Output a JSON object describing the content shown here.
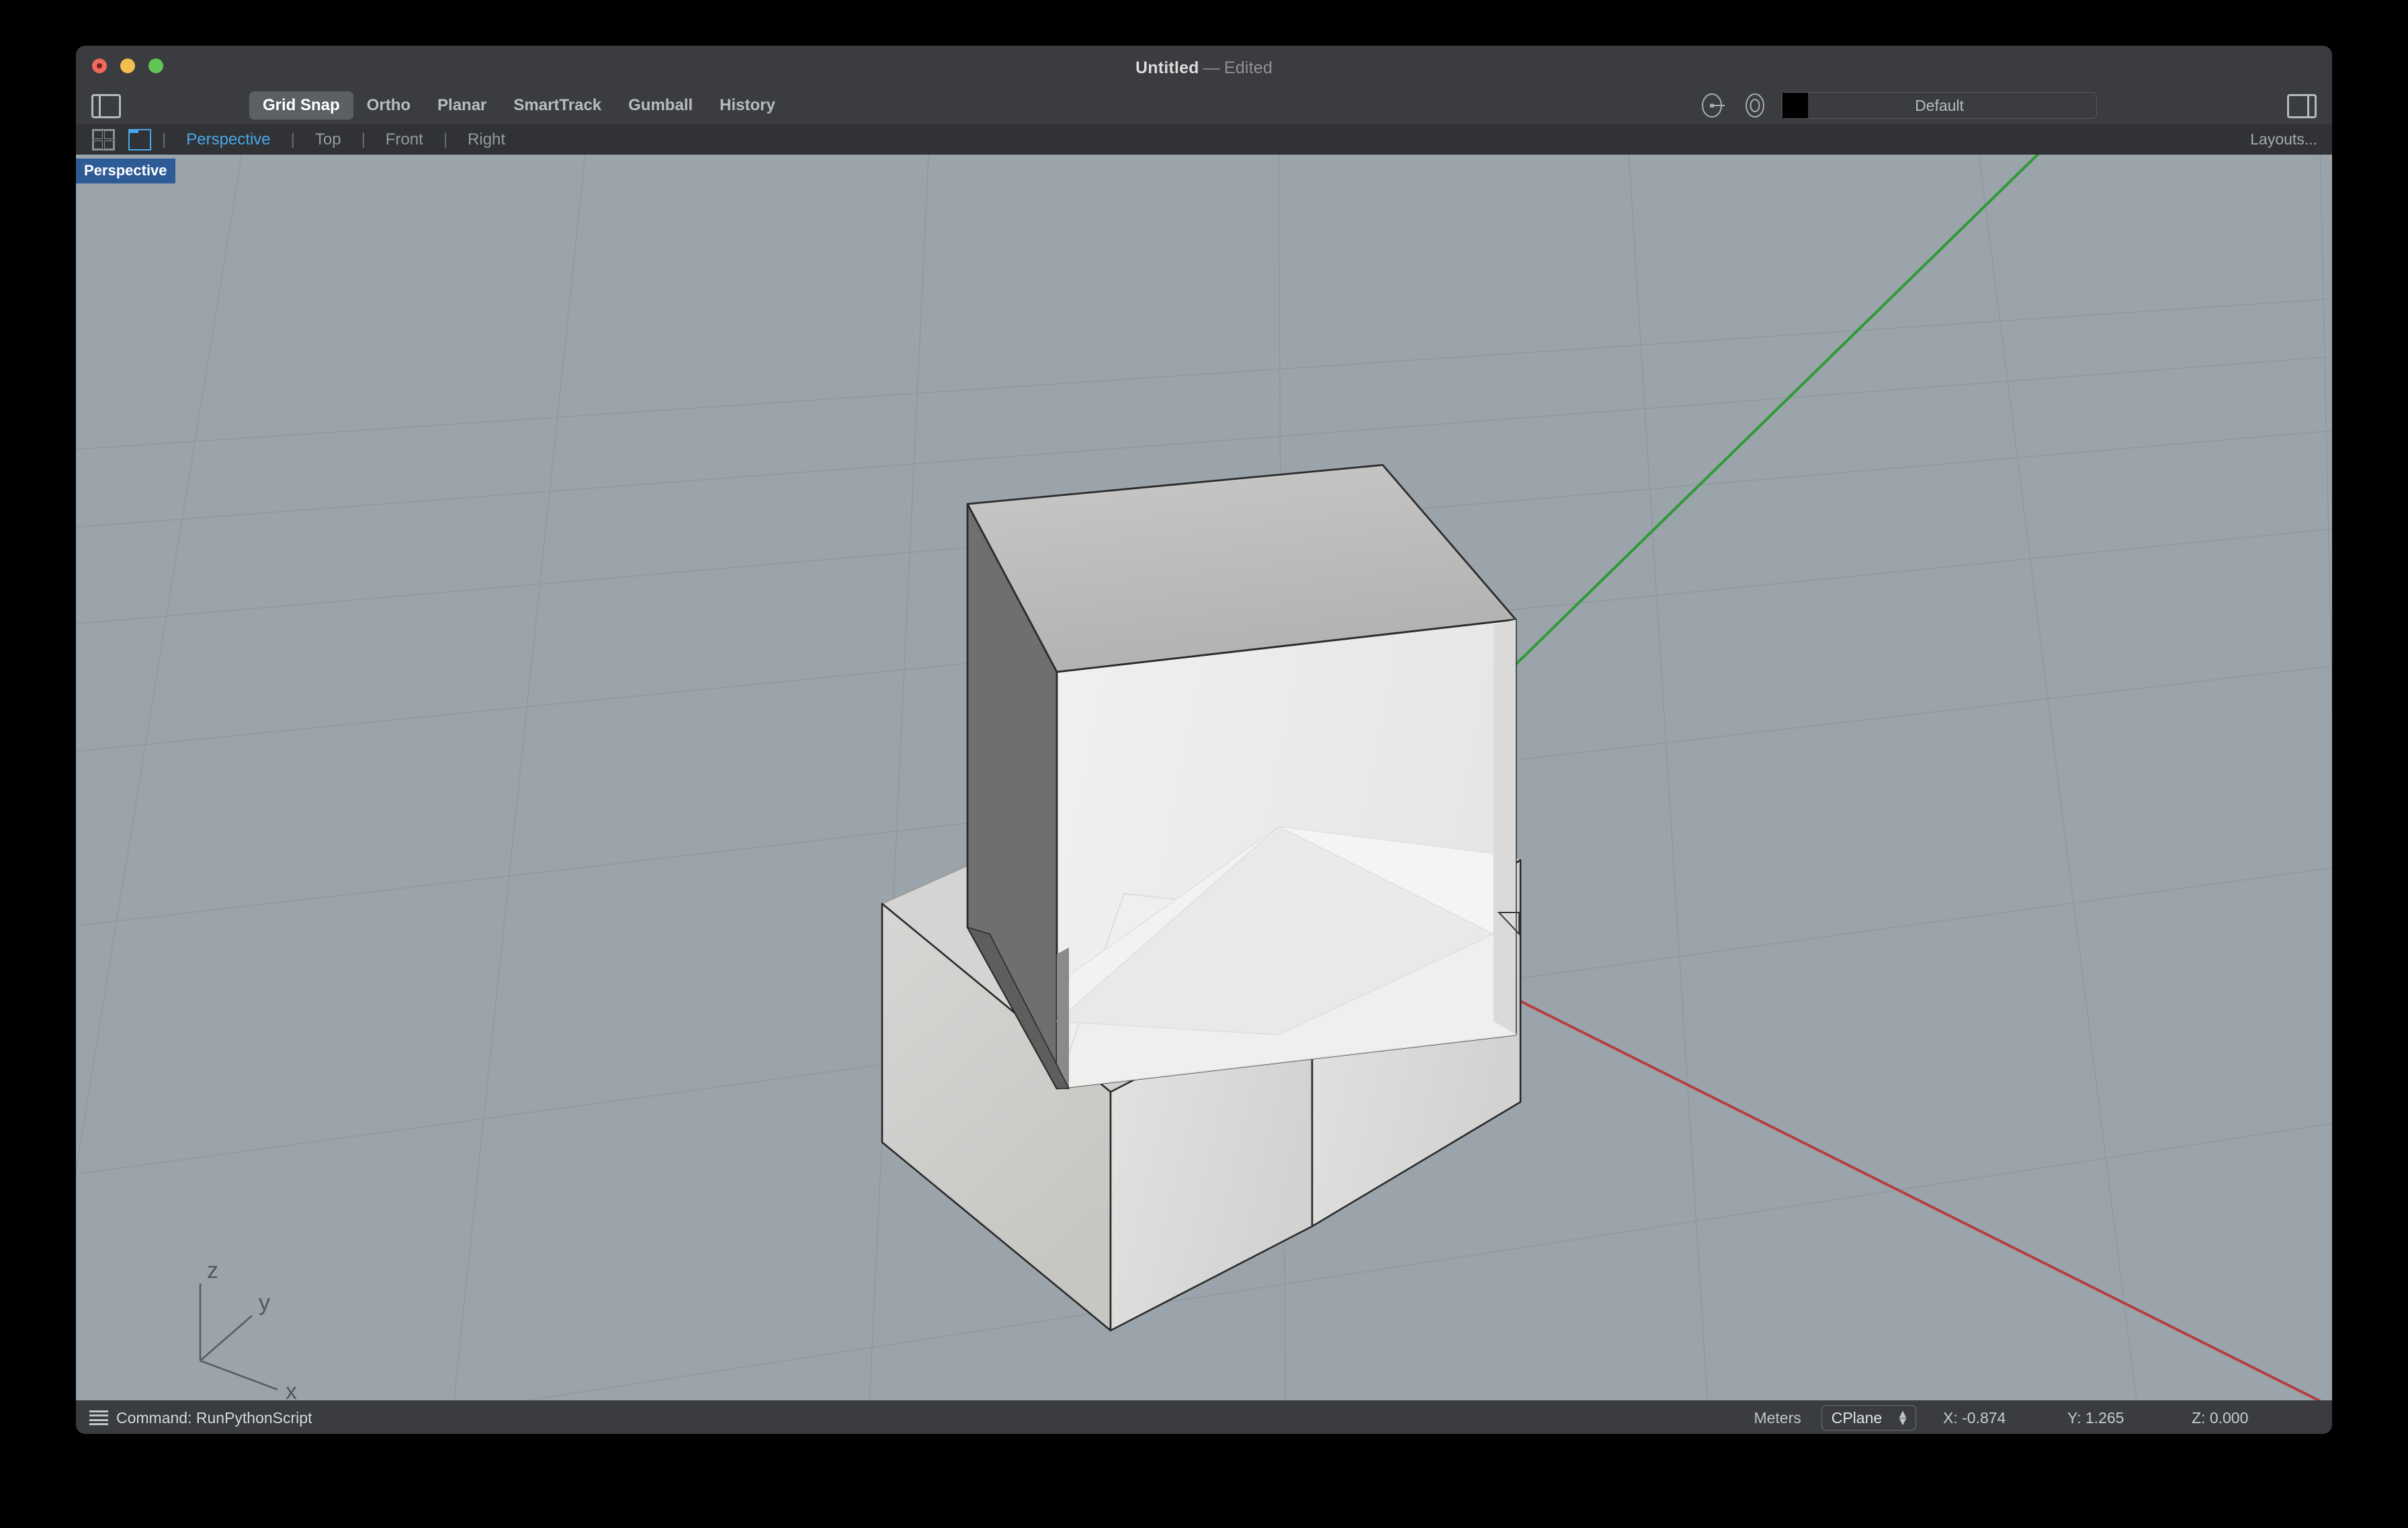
{
  "window": {
    "title": "Untitled",
    "title_separator": "—",
    "title_state": "Edited",
    "traffic_lights": [
      "close",
      "minimize",
      "maximize"
    ]
  },
  "toolbar": {
    "left_panel_toggle_icon": "sidebar-left-icon",
    "right_panel_toggle_icon": "sidebar-right-icon",
    "modes": [
      {
        "label": "Grid Snap",
        "active": true
      },
      {
        "label": "Ortho",
        "active": false
      },
      {
        "label": "Planar",
        "active": false
      },
      {
        "label": "SmartTrack",
        "active": false
      },
      {
        "label": "Gumball",
        "active": false
      },
      {
        "label": "History",
        "active": false
      }
    ],
    "layer_visibility_icon": "layer-state-icon",
    "layer_lock_icon": "layer-circle-icon",
    "layer_color": "#000000",
    "layer_name": "Default"
  },
  "viewport_tabs": {
    "four_view_icon": "four-viewport-layout-icon",
    "single_view_icon": "single-viewport-layout-icon",
    "separator": "|",
    "tabs": [
      {
        "label": "Perspective",
        "active": true
      },
      {
        "label": "Top",
        "active": false
      },
      {
        "label": "Front",
        "active": false
      },
      {
        "label": "Right",
        "active": false
      }
    ],
    "layouts_label": "Layouts..."
  },
  "viewport": {
    "label": "Perspective",
    "background_color": "#9ba3ab",
    "grid_line_color": "#8e969e",
    "x_axis_color": "#b54040",
    "y_axis_color": "#2e9b36",
    "axis_gizmo": {
      "z_label": "z",
      "y_label": "y",
      "x_label": "x"
    },
    "objects": [
      {
        "name": "upper-open-box",
        "type": "box",
        "shaded": true
      },
      {
        "name": "lower-open-box",
        "type": "box",
        "shaded": true
      }
    ]
  },
  "status_bar": {
    "command_menu_icon": "hamburger-icon",
    "command_label": "Command: RunPythonScript",
    "units": "Meters",
    "cplane_label": "CPlane",
    "cplane_arrows_icon": "updown-chevron-icon",
    "coord_x": "X: -0.874",
    "coord_y": "Y: 1.265",
    "coord_z": "Z: 0.000"
  }
}
